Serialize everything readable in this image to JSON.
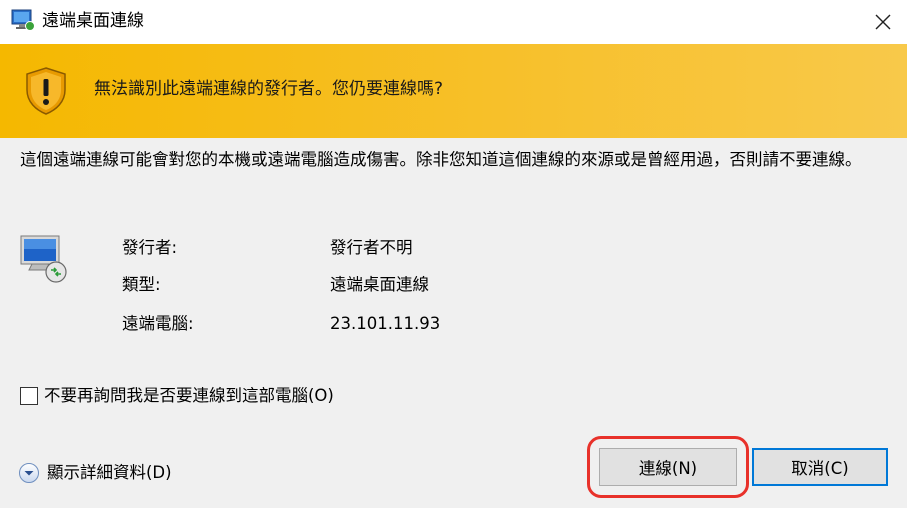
{
  "window": {
    "title": "遠端桌面連線"
  },
  "banner": {
    "message": "無法識別此遠端連線的發行者。您仍要連線嗎?"
  },
  "body": {
    "description": "這個遠端連線可能會對您的本機或遠端電腦造成傷害。除非您知道這個連線的來源或是曾經用過，否則請不要連線。",
    "info": {
      "publisher_label": "發行者:",
      "publisher_value": "發行者不明",
      "type_label": "類型:",
      "type_value": "遠端桌面連線",
      "remote_label": "遠端電腦:",
      "remote_value": "23.101.11.93"
    },
    "dont_ask": {
      "label": "不要再詢問我是否要連線到這部電腦(O)",
      "checked": false
    }
  },
  "footer": {
    "details_label": "顯示詳細資料(D)",
    "connect_label": "連線(N)",
    "cancel_label": "取消(C)"
  },
  "colors": {
    "banner": "#f5b800",
    "focus_border": "#0078d7",
    "highlight": "#e8312a"
  },
  "icons": {
    "title": "remote-desktop-icon",
    "close": "close-icon",
    "warning": "warning-shield-icon",
    "computer": "remote-computer-icon",
    "details": "chevron-down-icon"
  }
}
